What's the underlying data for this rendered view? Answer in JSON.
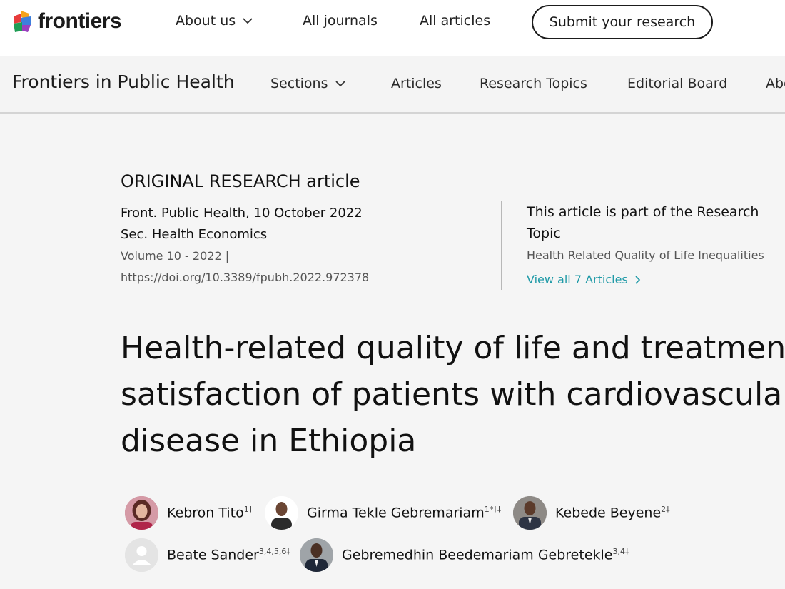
{
  "brand": {
    "name": "frontiers"
  },
  "topnav": {
    "about": "About us",
    "journals": "All journals",
    "articles": "All articles",
    "submit": "Submit your research"
  },
  "journal": {
    "title": "Frontiers in Public Health",
    "nav": {
      "sections": "Sections",
      "articles": "Articles",
      "topics": "Research Topics",
      "board": "Editorial Board",
      "about": "Abo"
    }
  },
  "article": {
    "type": "ORIGINAL RESEARCH article",
    "citation": "Front. Public Health, 10 October 2022",
    "section": "Sec. Health Economics",
    "volume": "Volume 10 - 2022 |",
    "doi": "https://doi.org/10.3389/fpubh.2022.972378",
    "title_lines": [
      "Health-related quality of life and treatment",
      "satisfaction of patients with cardiovascular",
      "disease in Ethiopia"
    ]
  },
  "research_topic": {
    "heading": "This article is part of the Research Topic",
    "name": "Health Related Quality of Life Inequalities",
    "link": "View all 7 Articles"
  },
  "authors": [
    {
      "name": "Kebron Tito",
      "sup": "1†"
    },
    {
      "name": "Girma Tekle Gebremariam",
      "sup": "1*†‡"
    },
    {
      "name": "Kebede Beyene",
      "sup": "2‡"
    },
    {
      "name": "Beate Sander",
      "sup": "3,4,5,6‡"
    },
    {
      "name": "Gebremedhin Beedemariam Gebretekle",
      "sup": "3,4‡"
    }
  ],
  "colors": {
    "link": "#1f9aa7",
    "text": "#111111",
    "background": "#f5f5f5"
  }
}
